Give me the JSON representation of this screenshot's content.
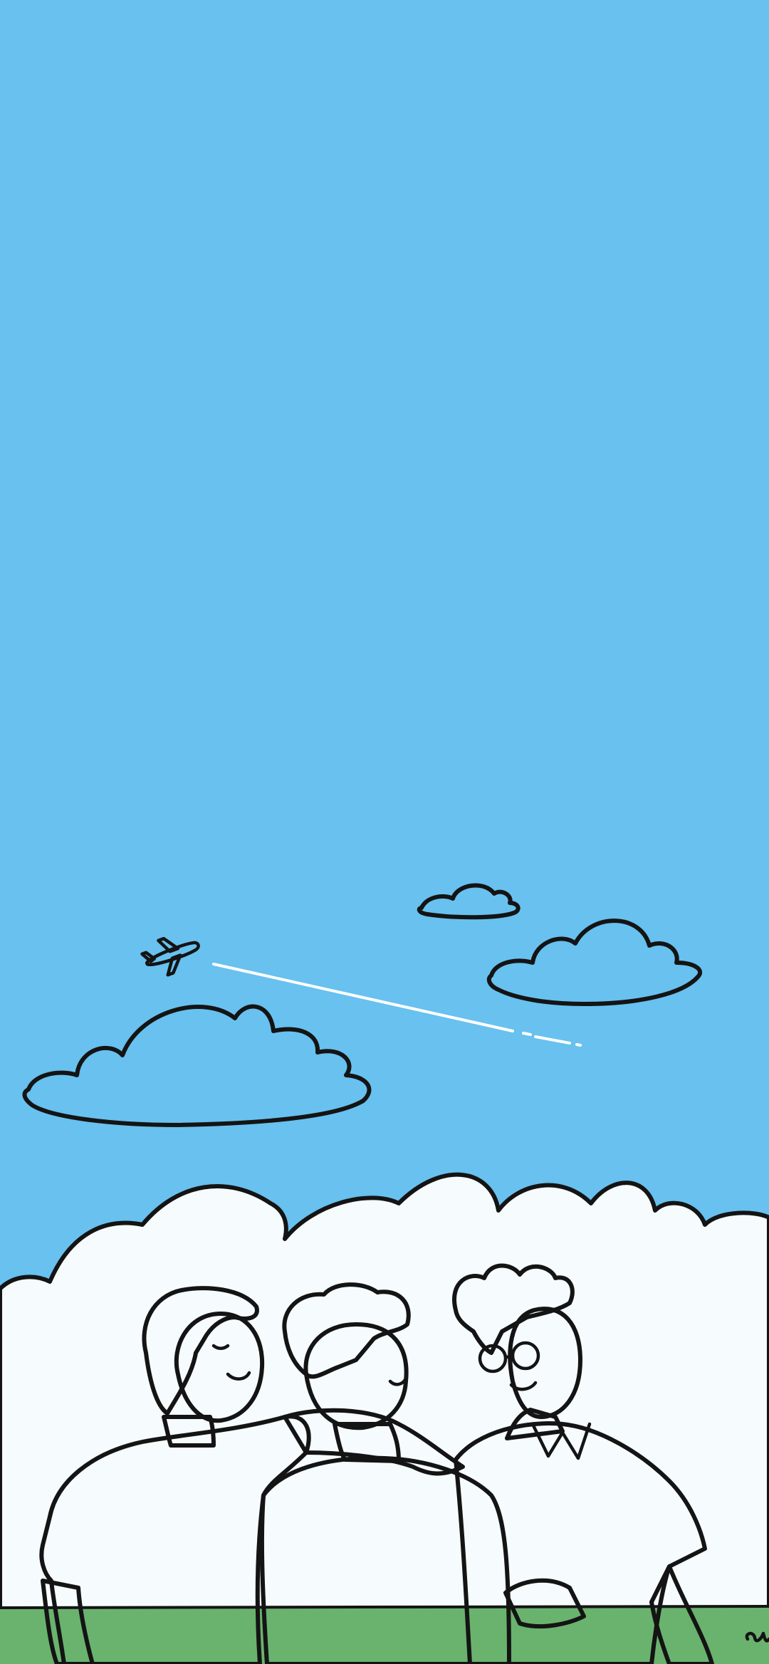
{
  "wallpaper": {
    "colors": {
      "sky": "#68c1ef",
      "cloud": "#ffffff",
      "cloud_bank": "#f6fbfe",
      "outline": "#141414",
      "shirt_left": "#f4a6ab",
      "shirt_middle": "#74d2cb",
      "shirt_right": "#f8c86a",
      "skin": "#fde1e0",
      "hair_left": "#f3c25a",
      "hair_middle": "#ec7c4d",
      "hair_right": "#d9644b",
      "grass": "#6ab36e"
    },
    "elements": [
      "airplane-icon",
      "contrail",
      "cloud-small",
      "cloud-medium",
      "cloud-large",
      "cloud-bank",
      "friend-left",
      "friend-middle",
      "friend-right",
      "grass-strip",
      "artist-signature"
    ]
  }
}
